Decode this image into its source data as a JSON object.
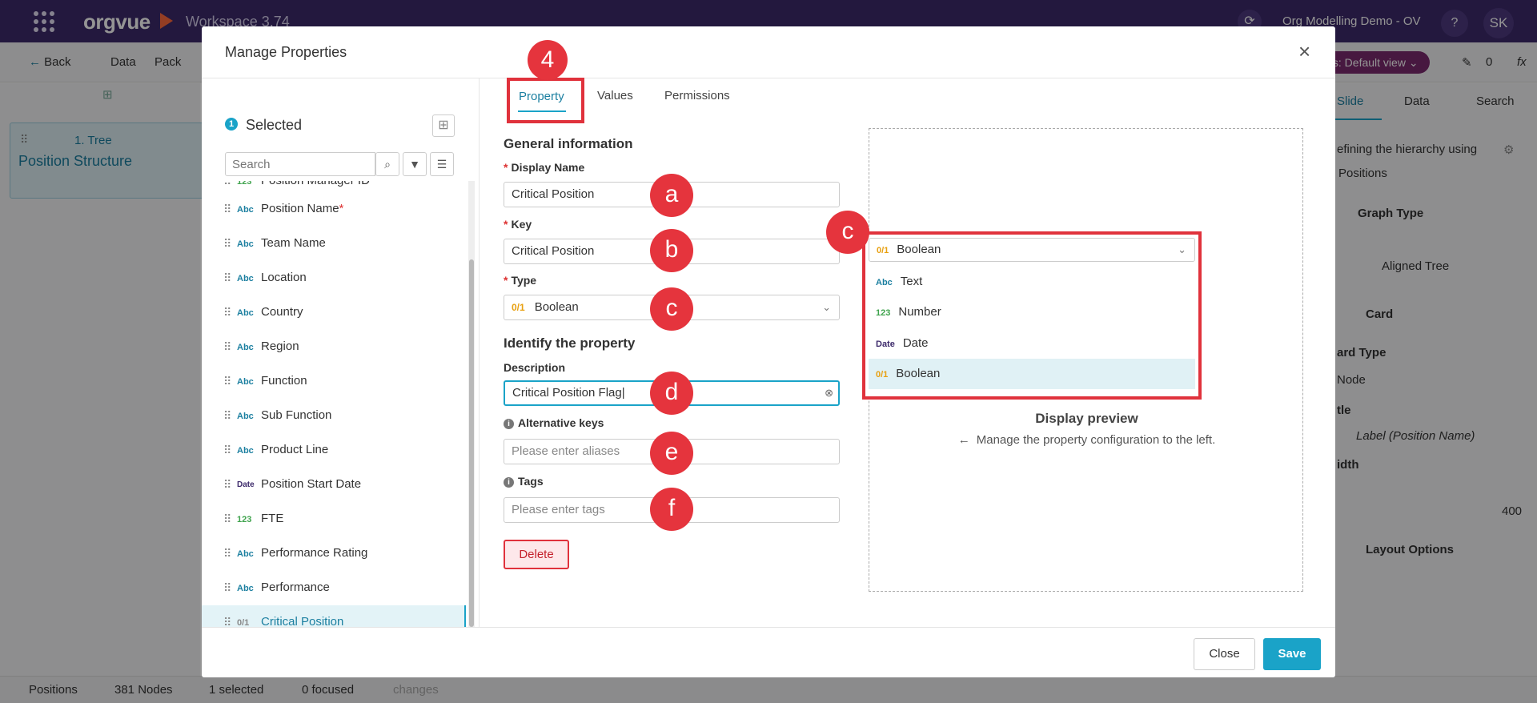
{
  "topbar": {
    "logo": "orgvue",
    "workspace": "Workspace 3.74",
    "project": "Org Modelling Demo - OV",
    "help": "?",
    "user_initials": "SK",
    "sync": "⟳"
  },
  "subbar": {
    "back": "Back",
    "menu": [
      "Data",
      "Pack"
    ],
    "view_pill": "ols: Default view ⌄",
    "alerts": "0",
    "fx": "fx"
  },
  "background": {
    "tree_card": {
      "label": "1. Tree",
      "title": "Position Structure"
    },
    "right_tabs": [
      "Slide",
      "Data",
      "Search"
    ],
    "right_panel": {
      "hint": "efining the hierarchy using",
      "hint2": "Positions",
      "graph_type": "Graph Type",
      "graph_value": "Aligned Tree",
      "card": "Card",
      "card_type_label": "ard Type",
      "card_type_value": "Node",
      "title_label": "tle",
      "title_value": "Label (Position Name)",
      "width_label": "idth",
      "width_value": "400",
      "layout": "Layout Options"
    },
    "statusbar": {
      "dataset": "Positions",
      "nodes": "381 Nodes",
      "selected": "1 selected",
      "focused": "0 focused",
      "changes": "changes"
    }
  },
  "modal": {
    "title": "Manage Properties",
    "selected_count": "1",
    "selected_label": "Selected",
    "search_placeholder": "Search",
    "partial_item": "Position Manager ID",
    "properties": [
      {
        "type": "Abc",
        "name": "Position Name",
        "required": "*"
      },
      {
        "type": "Abc",
        "name": "Team Name"
      },
      {
        "type": "Abc",
        "name": "Location"
      },
      {
        "type": "Abc",
        "name": "Country"
      },
      {
        "type": "Abc",
        "name": "Region"
      },
      {
        "type": "Abc",
        "name": "Function"
      },
      {
        "type": "Abc",
        "name": "Sub Function"
      },
      {
        "type": "Abc",
        "name": "Product Line"
      },
      {
        "type": "Date",
        "name": "Position Start Date"
      },
      {
        "type": "123",
        "name": "FTE"
      },
      {
        "type": "Abc",
        "name": "Performance Rating"
      },
      {
        "type": "Abc",
        "name": "Performance"
      },
      {
        "type": "0/1",
        "name": "Critical Position"
      }
    ],
    "tabs": [
      "Property",
      "Values",
      "Permissions"
    ],
    "form": {
      "general_title": "General information",
      "display_name_label": "Display Name",
      "display_name_value": "Critical Position",
      "key_label": "Key",
      "key_value": "Critical Position",
      "type_label": "Type",
      "type_value": "Boolean",
      "type_code": "0/1",
      "identify_title": "Identify the property",
      "description_label": "Description",
      "description_value": "Critical Position Flag",
      "alt_keys_label": "Alternative keys",
      "alt_keys_placeholder": "Please enter aliases",
      "tags_label": "Tags",
      "tags_placeholder": "Please enter tags",
      "delete_label": "Delete"
    },
    "preview": {
      "hidden_text": "Display preview",
      "hint": "Manage the property configuration to the left."
    },
    "dropdown": {
      "selected": {
        "code": "0/1",
        "label": "Boolean"
      },
      "options": [
        {
          "code": "Abc",
          "label": "Text"
        },
        {
          "code": "123",
          "label": "Number"
        },
        {
          "code": "Date",
          "label": "Date"
        },
        {
          "code": "0/1",
          "label": "Boolean"
        }
      ]
    },
    "footer": {
      "close": "Close",
      "save": "Save"
    }
  },
  "callouts": {
    "step": "4",
    "a": "a",
    "b": "b",
    "c": "c",
    "c2": "c",
    "d": "d",
    "e": "e",
    "f": "f"
  }
}
